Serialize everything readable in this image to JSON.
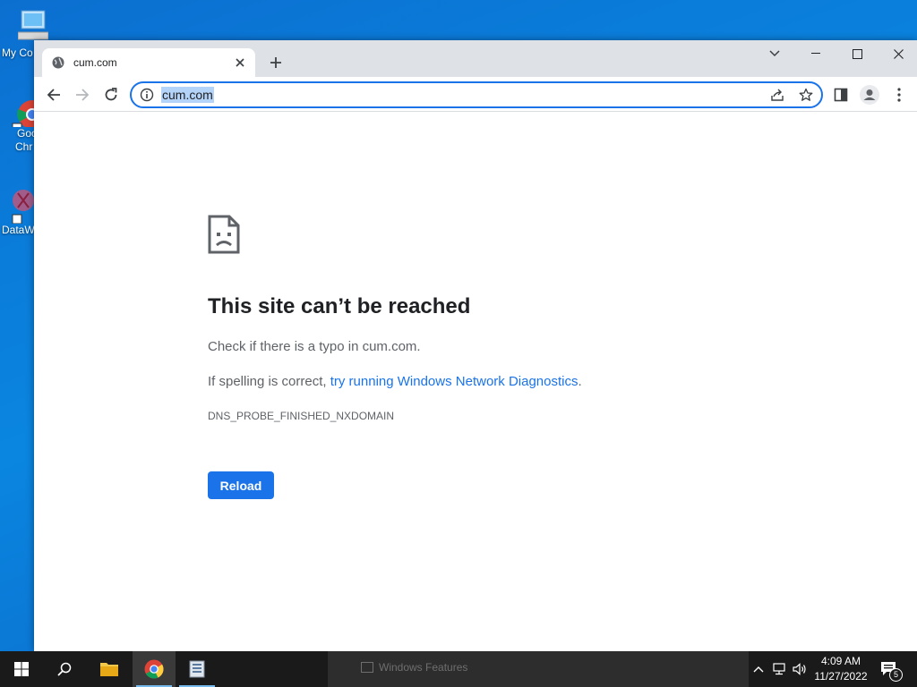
{
  "desktop": {
    "icons": [
      {
        "label": "My Co",
        "icon": "computer-icon"
      },
      {
        "label_line1": "Goo",
        "label_line2": "Chr",
        "icon": "chrome-icon"
      },
      {
        "label": "DataW",
        "icon": "datawrapper-icon"
      }
    ]
  },
  "browser": {
    "tab": {
      "title": "cum.com",
      "favicon": "globe-icon"
    },
    "omnibox": {
      "url": "cum.com"
    }
  },
  "error_page": {
    "heading": "This site can’t be reached",
    "check_text": "Check if there is a typo in cum.com.",
    "spelling_prefix": "If spelling is correct, ",
    "diagnostics_link": "try running Windows Network Diagnostics",
    "spelling_suffix": ".",
    "error_code": "DNS_PROBE_FINISHED_NXDOMAIN",
    "reload_label": "Reload"
  },
  "taskbar": {
    "background_window": "Windows Features",
    "clock_time": "4:09 AM",
    "clock_date": "11/27/2022",
    "notification_count": "5",
    "colors": {
      "accent": "#1a73e8",
      "taskbar": "#1a1a1a"
    }
  }
}
